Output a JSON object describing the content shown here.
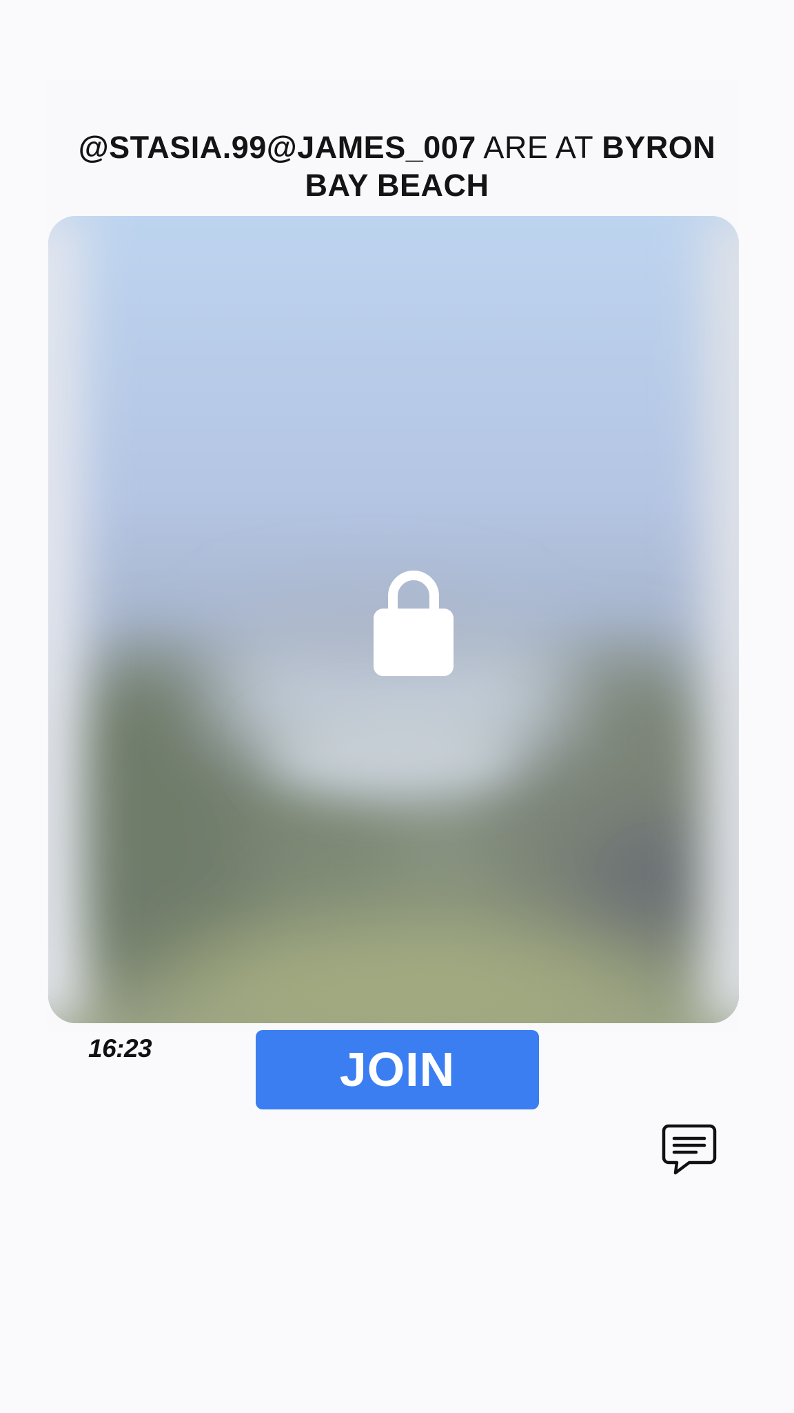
{
  "post": {
    "users": "@STASIA.99@JAMES_007",
    "connector": "ARE AT",
    "place": "BYRON BAY BEACH",
    "time": "16:23"
  },
  "actions": {
    "join_label": "JOIN"
  },
  "icons": {
    "lock": "lock-icon",
    "chat": "chat-bubble-icon"
  },
  "colors": {
    "join_button": "#3a7ef2",
    "text": "#141414",
    "background": "#fafafc"
  }
}
